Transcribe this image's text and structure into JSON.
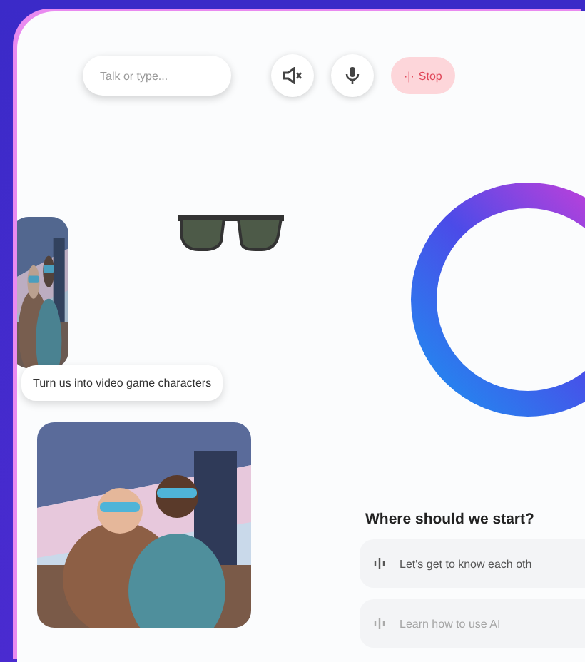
{
  "toolbar": {
    "input": {
      "placeholder": "Talk or type..."
    },
    "stop_button": {
      "icon": "·|·",
      "label": "Stop"
    }
  },
  "prompt": {
    "text": "Turn us into video game characters"
  },
  "suggestions": {
    "title": "Where should we start?",
    "items": [
      {
        "label": "Let's get to know each oth",
        "disabled": false
      },
      {
        "label": "Learn how to use AI",
        "disabled": true
      }
    ]
  }
}
